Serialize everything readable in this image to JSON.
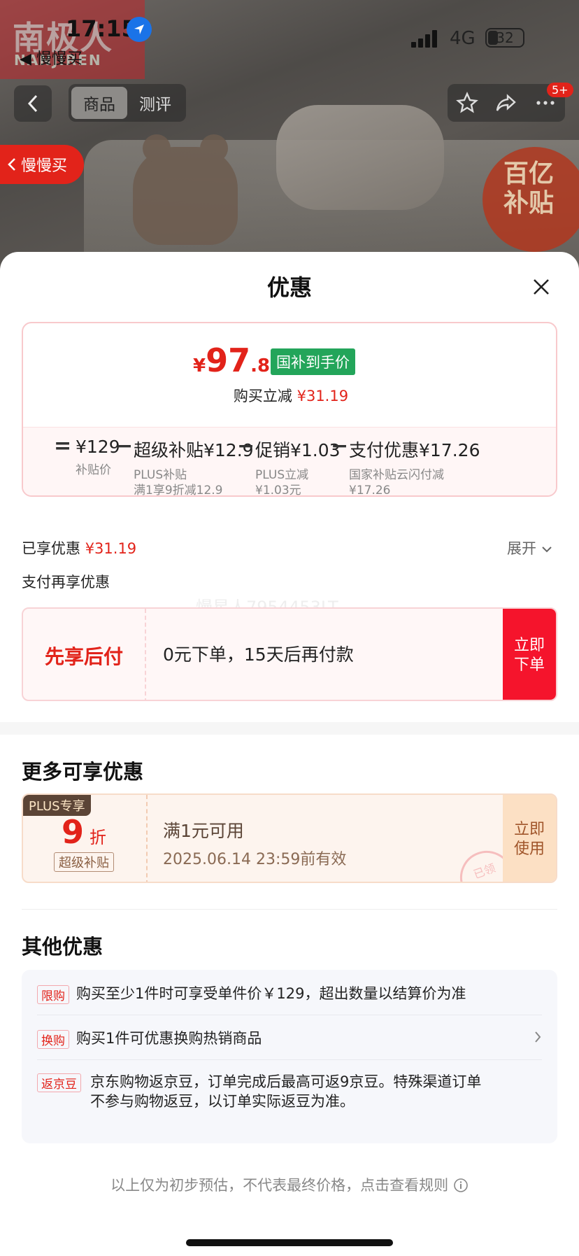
{
  "status_bar": {
    "time": "17:15",
    "back_app": "◀ 慢慢买",
    "network": "4G",
    "battery": "32"
  },
  "brand": {
    "logo_cn": "南极人",
    "logo_en": "NANJIREN"
  },
  "nav": {
    "tabs": [
      {
        "label": "商品"
      },
      {
        "label": "测评"
      }
    ],
    "active_tab": 0,
    "notification_count": "5+"
  },
  "manman": {
    "label": "慢慢买"
  },
  "subsidy_badge": {
    "line1": "百亿",
    "line2": "补贴"
  },
  "sheet": {
    "title": "优惠"
  },
  "price_card": {
    "currency": "¥",
    "price_int": "97",
    "price_dec": ".81",
    "tag": "国补到手价",
    "reduce_label": "购买立减",
    "reduce_value": "¥31.19",
    "formula": [
      {
        "main": "¥129",
        "sub1": "补贴价",
        "sub2": ""
      },
      {
        "main": "超级补贴¥12.9",
        "sub1": "PLUS补贴",
        "sub2": "满1享9折减12.9"
      },
      {
        "main": "促销¥1.03",
        "sub1": "PLUS立减",
        "sub2": "¥1.03元"
      },
      {
        "main": "支付优惠¥17.26",
        "sub1": "国家补贴云闪付减",
        "sub2": "¥17.26"
      }
    ],
    "ops": [
      "=",
      "−",
      "−",
      "−"
    ]
  },
  "enjoyed": {
    "label": "已享优惠",
    "value": "¥31.19",
    "expand": "展开"
  },
  "pay_section": {
    "title": "支付再享优惠",
    "watermark": "慢星人7954453LT"
  },
  "bnpl": {
    "title": "先享后付",
    "desc": "0元下单，15天后再付款",
    "cta": "立即下单"
  },
  "more": {
    "title": "更多可享优惠",
    "coupon": {
      "plus_tag": "PLUS专享",
      "discount": "9",
      "unit": "折",
      "kind": "超级补贴",
      "condition": "满1元可用",
      "expiry": "2025.06.14 23:59前有效",
      "cta": "立即使用",
      "stamp": "已领"
    }
  },
  "other": {
    "title": "其他优惠",
    "rows": [
      {
        "tag": "限购",
        "text": "购买至少1件时可享受单件价￥129，超出数量以结算价为准"
      },
      {
        "tag": "换购",
        "text": "购买1件可优惠换购热销商品"
      },
      {
        "tag": "返京豆",
        "text1": "京东购物返京豆，订单完成后最高可返9京豆。特殊渠道订单",
        "text2": "不参与购物返豆，以订单实际返豆为准。"
      }
    ]
  },
  "footnote": "以上仅为初步预估，不代表最终价格，点击查看规则",
  "colors": {
    "accent": "#e2231a",
    "green_tag": "#23a55a"
  }
}
